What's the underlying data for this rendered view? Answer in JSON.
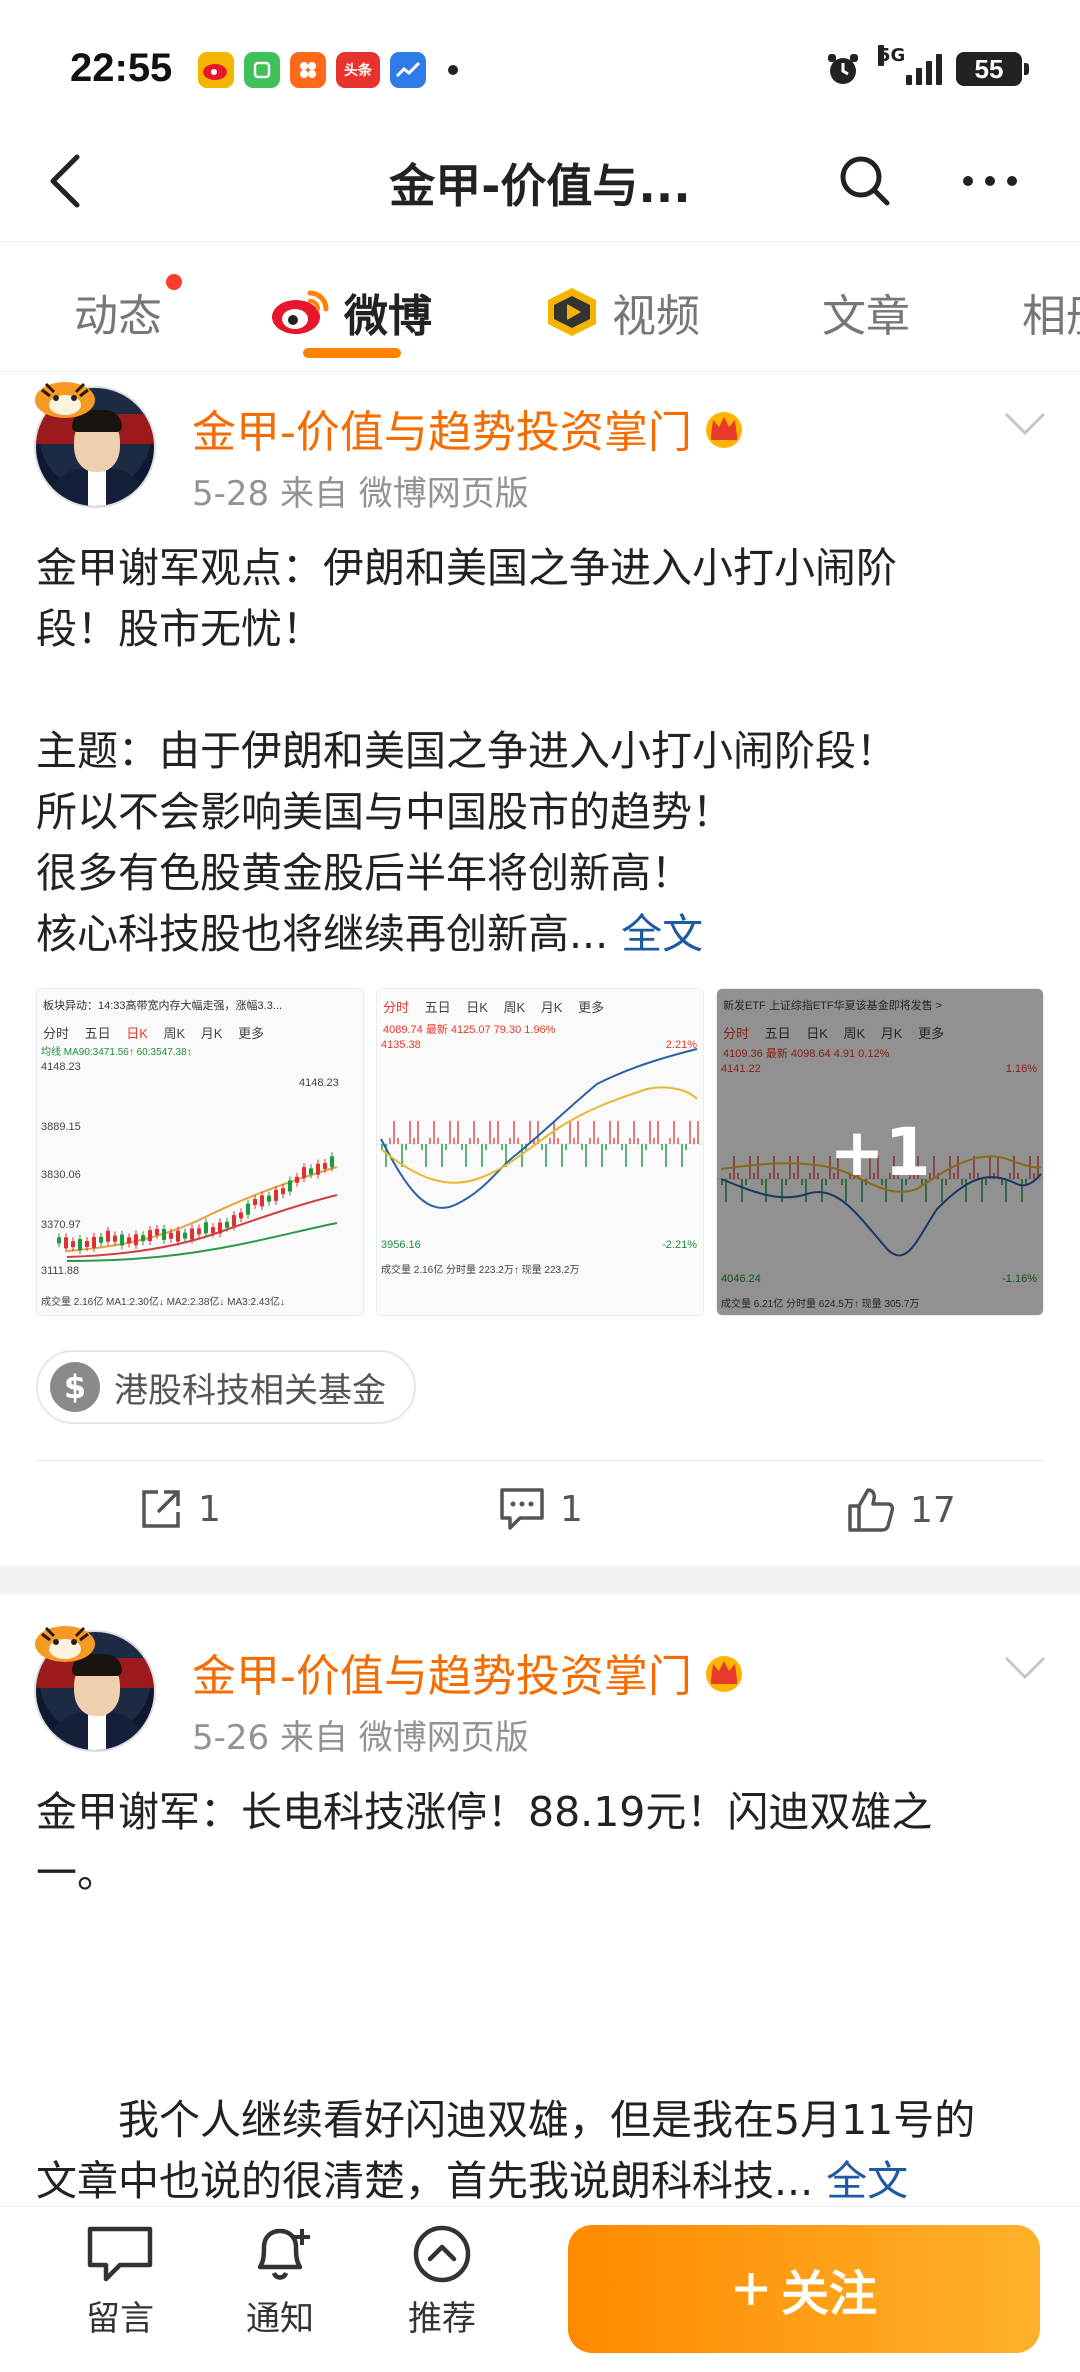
{
  "status_bar": {
    "time": "22:55",
    "network": "5G",
    "battery": "55",
    "app_icons": [
      {
        "name": "weibo-app-icon",
        "label": "微",
        "color": "#f5b400"
      },
      {
        "name": "green-app-icon",
        "label": "",
        "color": "#3fc05a"
      },
      {
        "name": "orange-app-icon",
        "label": "",
        "color": "#ff6a1a"
      },
      {
        "name": "toutiao-app-icon",
        "label": "头条",
        "color": "#e8332d"
      },
      {
        "name": "stock-app-icon",
        "label": "",
        "color": "#2f7be8"
      }
    ]
  },
  "nav": {
    "title": "金甲-价值与..."
  },
  "tabs": [
    {
      "label": "动态",
      "active": false,
      "has_dot": true
    },
    {
      "label": "微博",
      "active": true
    },
    {
      "label": "视频",
      "active": false
    },
    {
      "label": "文章",
      "active": false
    },
    {
      "label": "相册",
      "active": false
    }
  ],
  "colors": {
    "accent": "#ff8200",
    "username": "#f56c00",
    "link": "#1e5aa0"
  },
  "posts": [
    {
      "author": "金甲-价值与趋势投资掌门",
      "meta": "5-28  来自 微博网页版",
      "text_lines": [
        "金甲谢军观点：伊朗和美国之争进入小打小闹阶",
        "段！股市无忧！",
        "",
        "主题：由于伊朗和美国之争进入小打小闹阶段！",
        "所以不会影响美国与中国股市的趋势！",
        "很多有色股黄金股后半年将创新高！",
        "核心科技股也将继续再创新高..."
      ],
      "full_text_link": "全文",
      "thumbnails": [
        {
          "header": "板块异动：14:33高带宽内存大幅走强，涨幅3.3...",
          "tabs": [
            "分时",
            "五日",
            "日K",
            "周K",
            "月K",
            "更多"
          ],
          "ma_line": "均线 MA90:3471.56↑ 60:3547.38↑",
          "y_labels": [
            "4148.23",
            "3889.15",
            "3830.06",
            "3370.97",
            "3111.88"
          ],
          "footer": "成交量 2.16亿  MA1:2.30亿↓  MA2:2.38亿↓  MA3:2.43亿↓",
          "peak_label": "4148.23"
        },
        {
          "tabs": [
            "分时",
            "五日",
            "日K",
            "周K",
            "月K",
            "更多"
          ],
          "quote": "4089.74  最新 4125.07  79.30  1.96%",
          "y_labels": [
            "4135.38",
            "3956.16"
          ],
          "pct_top": "2.21%",
          "pct_bottom": "-2.21%",
          "footer": "成交量 2.16亿  分时量 223.2万↑  现量 223.2万"
        },
        {
          "header": "新发ETF  上证综指ETF华夏该基金即将发售 >",
          "tabs": [
            "分时",
            "五日",
            "日K",
            "周K",
            "月K",
            "更多"
          ],
          "quote": "4109.36  最新 4098.64  4.91  0.12%",
          "y_labels": [
            "4141.22",
            "4046.24"
          ],
          "pct_top": "1.16%",
          "pct_bottom": "-1.16%",
          "footer": "成交量 6.21亿  分时量 624.5万↑  现量 305.7万",
          "overlay": "+1"
        }
      ],
      "topic": "港股科技相关基金",
      "share_count": "1",
      "comment_count": "1",
      "like_count": "17"
    },
    {
      "author": "金甲-价值与趋势投资掌门",
      "meta": "5-26  来自 微博网页版",
      "text_lines": [
        "金甲谢军：长电科技涨停！88.19元！闪迪双雄之",
        "一。"
      ],
      "text_lines_2": [
        "　　我个人继续看好闪迪双雄，但是我在5月11号的",
        "文章中也说的很清楚，首先我说朗科科技..."
      ],
      "full_text_link": "全文"
    }
  ],
  "bottom_bar": {
    "comment_label": "留言",
    "notify_label": "通知",
    "recommend_label": "推荐",
    "follow_label": "关注"
  }
}
